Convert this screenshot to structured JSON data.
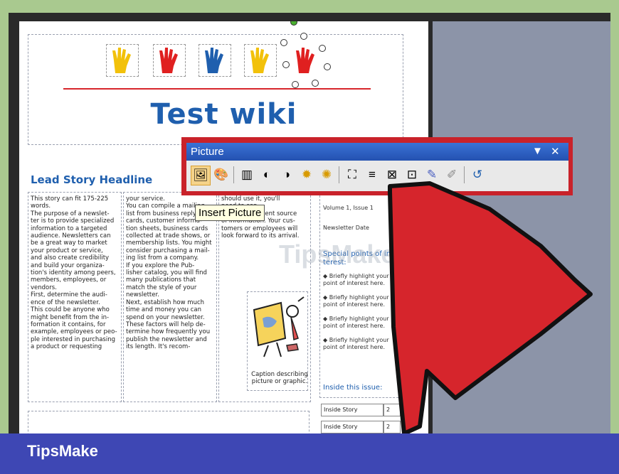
{
  "document": {
    "title": "Test wiki",
    "headline": "Lead Story Headline",
    "column1": "This story can fit 175-225\nwords.\nThe purpose of a newslet-\nter is to provide specialized\ninformation to a targeted\naudience. Newsletters can\nbe a great way to market\nyour product or service,\nand also create credibility\nand build your organiza-\ntion's identity among peers,\nmembers, employees, or\nvendors.\nFirst, determine the audi-\nence of the newsletter.\nThis could be anyone who\nmight benefit from the in-\nformation it contains, for\nexample, employees or peo-\nple interested in purchasing\na product or requesting",
    "column2": "your service.\nYou can compile a mailing\nlist from business reply\ncards, customer informa-\ntion sheets, business cards\ncollected at trade shows, or\nmembership lists. You might\nconsider purchasing a mail-\ning list from a company.\nIf you explore the Pub-\nlisher catalog, you will find\nmany publications that\nmatch the style of your\nnewsletter.\nNext, establish how much\ntime and money you can\nspend on your newsletter.\nThese factors will help de-\ntermine how frequently you\npublish the newsletter and\nits length. It's recom-",
    "column3": "should use it, you'll\nneed to con-\nsider a consistent source\nof information. Your cus-\ntomers or employees will\nlook forward to its arrival.",
    "caption": "Caption describing\npicture or graphic.",
    "sidebar": {
      "volume": "Volume 1, Issue 1",
      "date": "Newsletter Date",
      "special_title": "Special points of in-\nterest:",
      "bullets": [
        "Briefly highlight your\npoint of interest here.",
        "Briefly highlight your\npoint of interest here.",
        "Briefly highlight your\npoint of interest here.",
        "Briefly highlight your\npoint of interest here."
      ],
      "inside_title": "Inside this issue:",
      "inside_rows": [
        {
          "label": "Inside Story",
          "page": "2"
        },
        {
          "label": "Inside Story",
          "page": "2"
        }
      ]
    }
  },
  "toolbar": {
    "title": "Picture",
    "dropdown_glyph": "▼",
    "close_glyph": "✕",
    "buttons": [
      {
        "name": "insert-picture-icon",
        "glyph": "🖼"
      },
      {
        "name": "color-icon",
        "glyph": "🎨"
      },
      {
        "name": "format-picture-icon",
        "glyph": "▥"
      },
      {
        "name": "more-contrast-icon",
        "glyph": "◐"
      },
      {
        "name": "less-contrast-icon",
        "glyph": "◑"
      },
      {
        "name": "more-brightness-icon",
        "glyph": "✹"
      },
      {
        "name": "less-brightness-icon",
        "glyph": "✺"
      },
      {
        "name": "crop-icon",
        "glyph": "⛶"
      },
      {
        "name": "line-style-icon",
        "glyph": "≡"
      },
      {
        "name": "compress-pictures-icon",
        "glyph": "⊠"
      },
      {
        "name": "text-wrapping-icon",
        "glyph": "⊡"
      },
      {
        "name": "format-object-icon",
        "glyph": "✎"
      },
      {
        "name": "set-transparent-color-icon",
        "glyph": "✐"
      },
      {
        "name": "reset-picture-icon",
        "glyph": "↺"
      }
    ]
  },
  "tooltip": "Insert Picture",
  "watermark": "TipsMake",
  "brand": "TipsMake",
  "colors": {
    "accent": "#1f5fae",
    "callout_red": "#c9222a",
    "banner": "#3e47b4"
  }
}
